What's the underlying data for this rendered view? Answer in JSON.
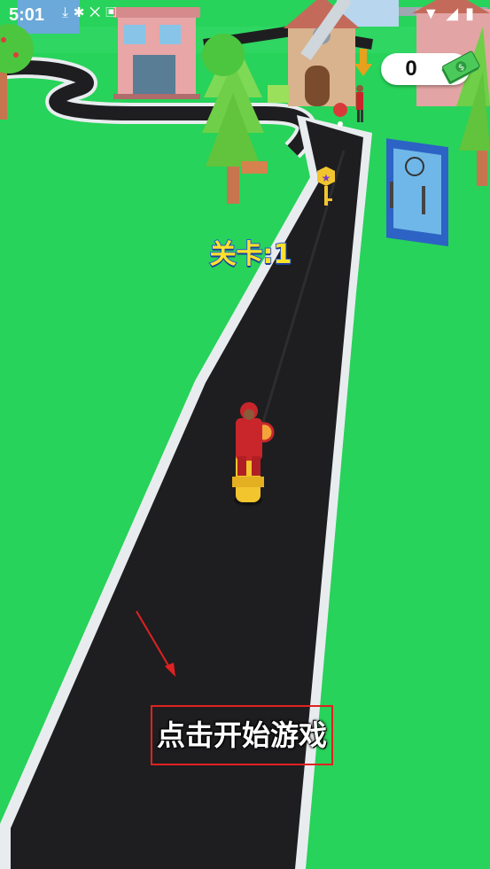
{
  "status_bar": {
    "time": "5:01",
    "left_icons": [
      "download-icon",
      "settings-icon",
      "notification-icon",
      "app-icon"
    ],
    "right_icons": [
      "wifi-icon",
      "cell-signal-icon",
      "battery-icon"
    ]
  },
  "hud": {
    "cash_value": "0",
    "cash_icon": "cash-stack-icon"
  },
  "level": {
    "label": "关卡:1"
  },
  "tutorial": {
    "start_prompt": "点击开始游戏",
    "arrow_icon": "pointer-arrow-icon"
  },
  "colors": {
    "grass": "#27d35a",
    "road": "#1e1e20",
    "road_border": "#e9ecef",
    "level_text": "#ffe12b",
    "level_outline": "#2a5bd7",
    "highlight_box": "#e02121",
    "rider_jacket": "#c8262b",
    "scooter": "#f2c52e"
  }
}
